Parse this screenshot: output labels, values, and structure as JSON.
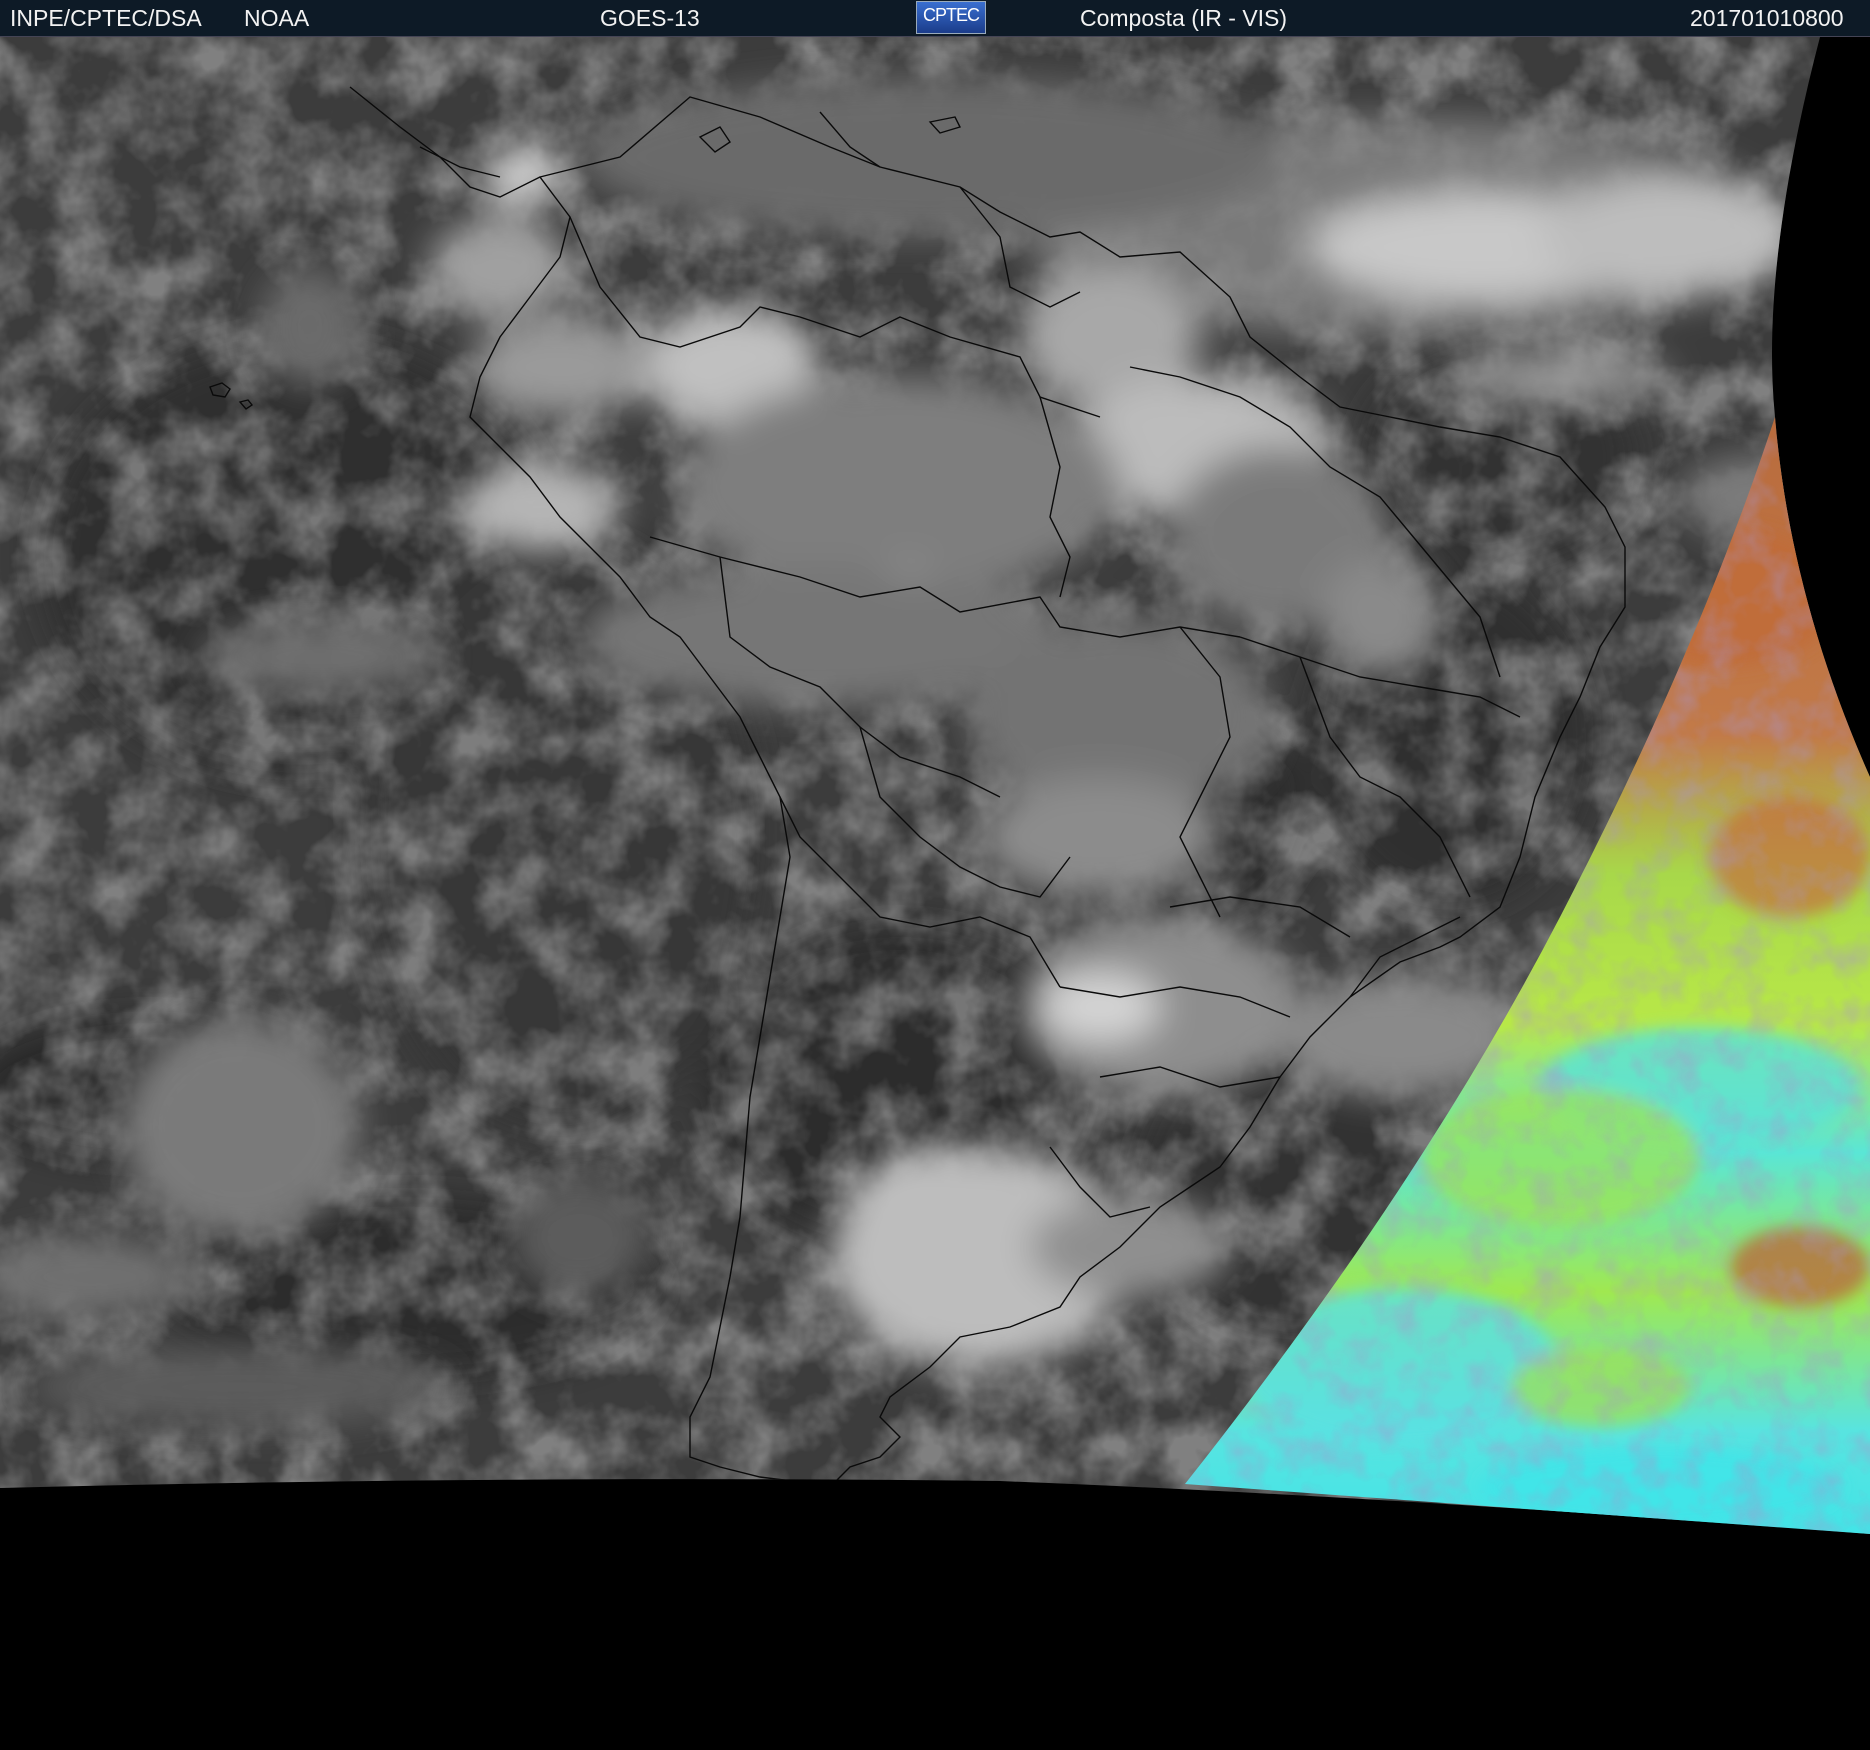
{
  "header": {
    "org": "INPE/CPTEC/DSA",
    "agency": "NOAA",
    "satellite": "GOES-13",
    "logo_text": "CPTEC",
    "product": "Composta (IR - VIS)",
    "timestamp": "201701010800"
  },
  "colors": {
    "header_bg": "#0d1a26",
    "ocean_gray": "#3a3a3a",
    "space_black": "#000000",
    "cloud_white": "#d8d8d8",
    "vis_orange": "#c07040",
    "vis_yellowgreen": "#a8e040",
    "vis_cyan": "#40e0e0"
  },
  "map": {
    "region": "South America",
    "layers": [
      "ir-grayscale",
      "vis-color-terminator",
      "political-borders"
    ]
  }
}
